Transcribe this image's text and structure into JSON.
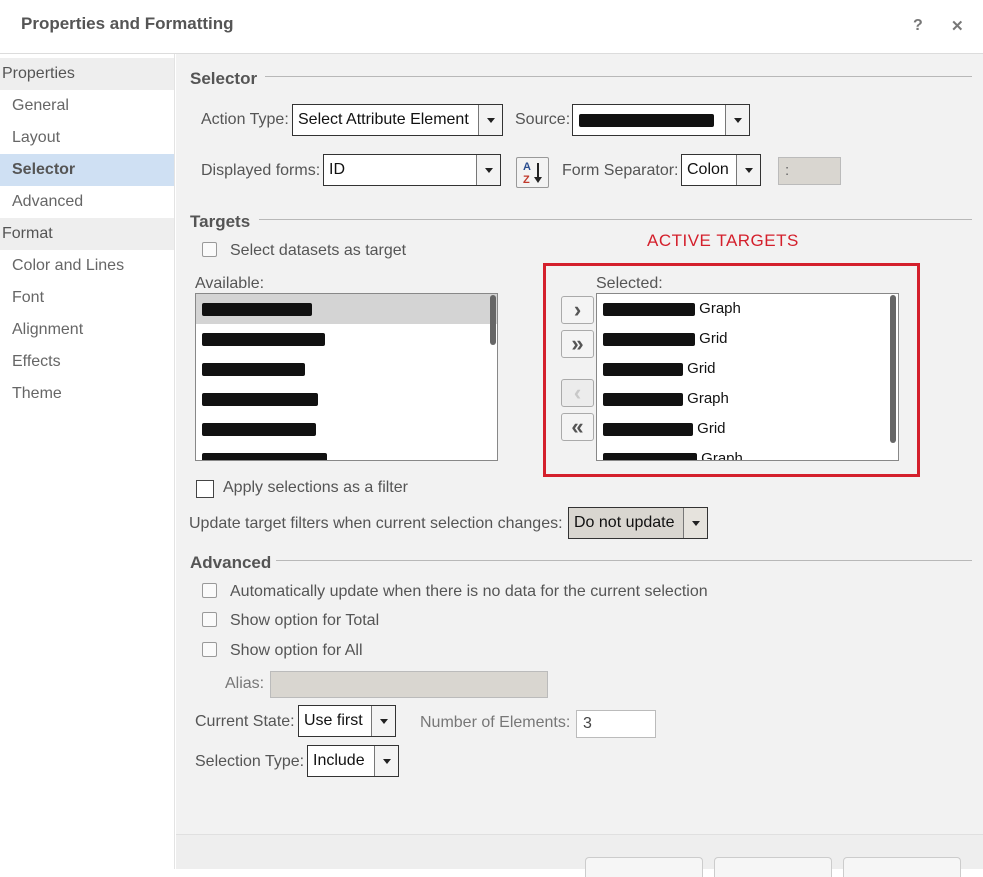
{
  "window": {
    "title": "Properties and Formatting",
    "help_label": "?",
    "close_label": "✕"
  },
  "sidebar": {
    "properties_group": "Properties",
    "properties_items": [
      "General",
      "Layout",
      "Selector",
      "Advanced"
    ],
    "format_group": "Format",
    "format_items": [
      "Color and Lines",
      "Font",
      "Alignment",
      "Effects",
      "Theme"
    ],
    "active_item": "Selector"
  },
  "selector": {
    "heading": "Selector",
    "action_type_label": "Action Type:",
    "action_type_value": "Select Attribute Element",
    "source_label": "Source:",
    "source_value": "",
    "displayed_forms_label": "Displayed forms:",
    "displayed_forms_value": "ID",
    "form_separator_label": "Form Separator:",
    "form_separator_value": "Colon",
    "separator_char": ":"
  },
  "targets": {
    "heading": "Targets",
    "select_datasets_label": "Select datasets as target",
    "available_label": "Available:",
    "selected_label": "Selected:",
    "annotation": "ACTIVE TARGETS",
    "selected_items": [
      {
        "suffix": "Graph"
      },
      {
        "suffix": "Grid"
      },
      {
        "suffix": "Grid"
      },
      {
        "suffix": "Graph"
      },
      {
        "suffix": "Grid"
      },
      {
        "suffix": "Graph"
      }
    ],
    "apply_filter_label": "Apply selections as a filter",
    "update_filters_label": "Update target filters when current selection changes:",
    "update_filters_value": "Do not update"
  },
  "advanced": {
    "heading": "Advanced",
    "auto_update_label": "Automatically update when there is no data for the current selection",
    "show_total_label": "Show option for Total",
    "show_all_label": "Show option for All",
    "alias_label": "Alias:",
    "current_state_label": "Current State:",
    "current_state_value": "Use first",
    "num_elements_label": "Number of Elements:",
    "num_elements_value": "3",
    "selection_type_label": "Selection Type:",
    "selection_type_value": "Include"
  },
  "colors": {
    "accent_red": "#d4202c",
    "active_nav": "#cfe0f3",
    "panel_bg": "#f2f2f2"
  },
  "icons": [
    "help-icon",
    "close-icon",
    "sort-az-icon",
    "move-right-icon",
    "move-all-right-icon",
    "move-left-icon",
    "move-all-left-icon",
    "dropdown-arrow-icon"
  ]
}
